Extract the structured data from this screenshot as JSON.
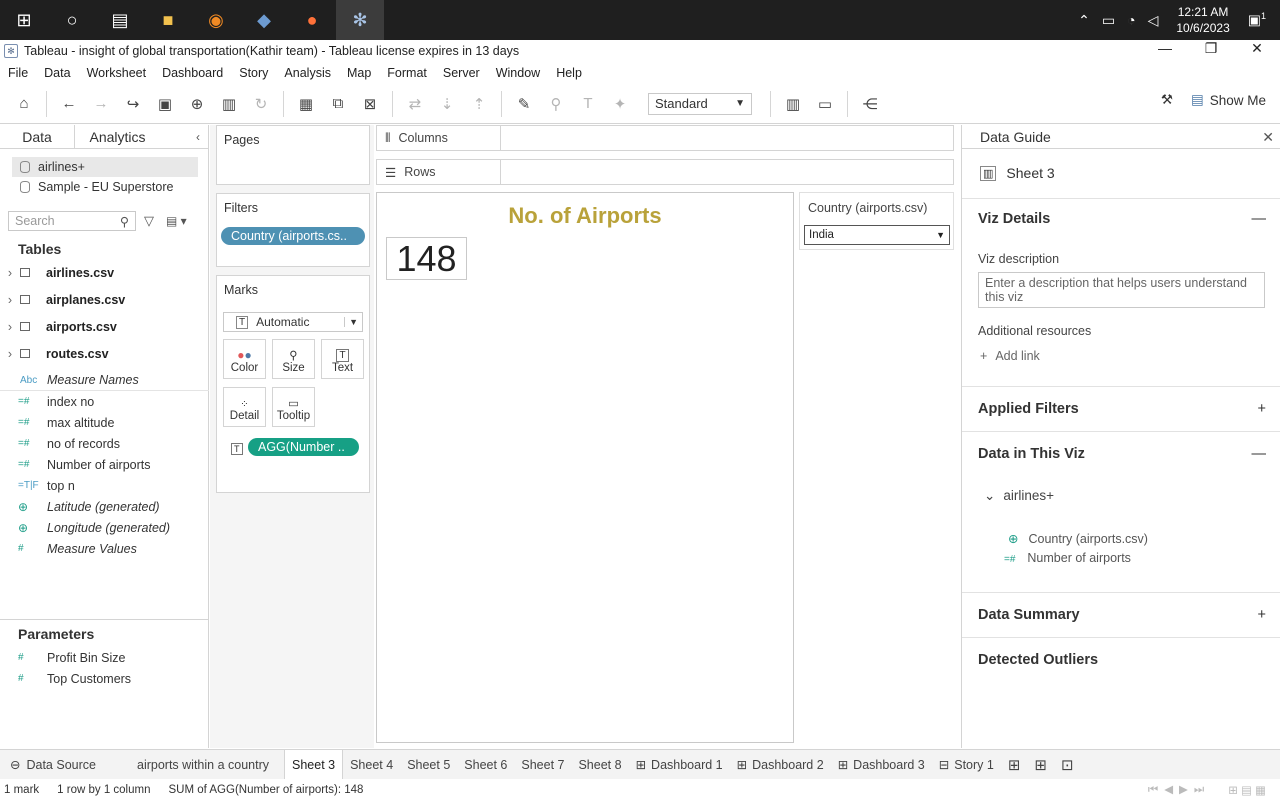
{
  "taskbar": {
    "time": "12:21 AM",
    "date": "10/6/2023",
    "notification_count": "1"
  },
  "window": {
    "title": "Tableau - insight of global transportation(Kathir team) - Tableau license expires in 13 days"
  },
  "menu": [
    "File",
    "Data",
    "Worksheet",
    "Dashboard",
    "Story",
    "Analysis",
    "Map",
    "Format",
    "Server",
    "Window",
    "Help"
  ],
  "toolbar": {
    "fit_select": "Standard",
    "show_me": "Show Me"
  },
  "data_pane": {
    "tabs": [
      "Data",
      "Analytics"
    ],
    "datasources": [
      "airlines+",
      "Sample - EU Superstore"
    ],
    "search_placeholder": "Search",
    "tables_header": "Tables",
    "tables": [
      "airlines.csv",
      "airplanes.csv",
      "airports.csv",
      "routes.csv"
    ],
    "fields": [
      {
        "icon": "Abc",
        "name": "Measure Names"
      },
      {
        "icon": "=#",
        "name": "index no"
      },
      {
        "icon": "=#",
        "name": "max altitude"
      },
      {
        "icon": "=#",
        "name": "no of records"
      },
      {
        "icon": "=#",
        "name": "Number of airports"
      },
      {
        "icon": "=T|F",
        "name": "top n"
      },
      {
        "icon": "globe",
        "name": "Latitude (generated)"
      },
      {
        "icon": "globe",
        "name": "Longitude (generated)"
      },
      {
        "icon": "#",
        "name": "Measure Values"
      }
    ],
    "parameters_header": "Parameters",
    "parameters": [
      "Profit Bin Size",
      "Top Customers"
    ]
  },
  "shelves": {
    "pages": "Pages",
    "filters": "Filters",
    "filter_pill": "Country (airports.cs..",
    "marks": "Marks",
    "mark_type": "Automatic",
    "mark_buttons": [
      "Color",
      "Size",
      "Text",
      "Detail",
      "Tooltip"
    ],
    "marks_pill": "AGG(Number ..",
    "columns": "Columns",
    "rows": "Rows"
  },
  "view": {
    "title": "No. of Airports",
    "kpi_value": "148",
    "title_color": "#b9a23a"
  },
  "filter_card": {
    "title": "Country (airports.csv)",
    "value": "India"
  },
  "data_guide": {
    "header": "Data Guide",
    "sheet": "Sheet 3",
    "viz_details": "Viz Details",
    "viz_description_label": "Viz description",
    "viz_description_placeholder": "Enter a description that helps users understand this viz",
    "additional_resources": "Additional resources",
    "add_link": "Add link",
    "applied_filters": "Applied Filters",
    "data_in_viz": "Data in This Viz",
    "datasource": "airlines+",
    "viz_fields": [
      "Country (airports.csv)",
      "Number of airports"
    ],
    "data_summary": "Data Summary",
    "detected_outliers": "Detected Outliers"
  },
  "tabs": [
    "Data Source",
    "airports within a country",
    "Sheet 3",
    "Sheet 4",
    "Sheet 5",
    "Sheet 6",
    "Sheet 7",
    "Sheet 8",
    "Dashboard 1",
    "Dashboard 2",
    "Dashboard 3",
    "Story 1"
  ],
  "status": {
    "marks": "1 mark",
    "dims": "1 row by 1 column",
    "sum": "SUM of AGG(Number of airports): 148"
  }
}
